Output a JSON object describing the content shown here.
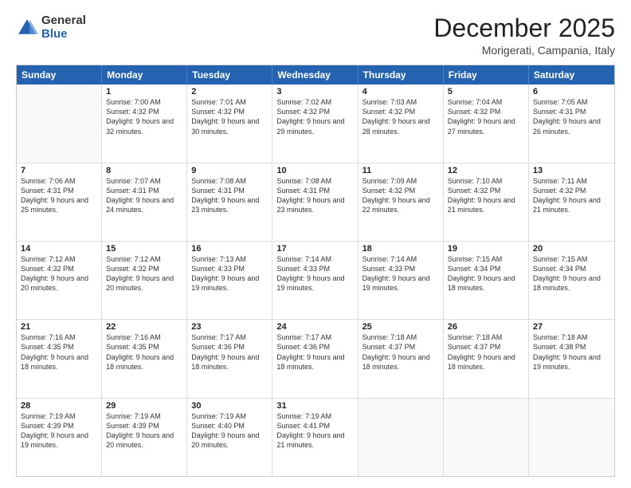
{
  "logo": {
    "general": "General",
    "blue": "Blue"
  },
  "header": {
    "title": "December 2025",
    "subtitle": "Morigerati, Campania, Italy"
  },
  "weekdays": [
    "Sunday",
    "Monday",
    "Tuesday",
    "Wednesday",
    "Thursday",
    "Friday",
    "Saturday"
  ],
  "rows": [
    [
      {
        "day": "",
        "sunrise": "",
        "sunset": "",
        "daylight": "",
        "empty": true
      },
      {
        "day": "1",
        "sunrise": "Sunrise: 7:00 AM",
        "sunset": "Sunset: 4:32 PM",
        "daylight": "Daylight: 9 hours and 32 minutes."
      },
      {
        "day": "2",
        "sunrise": "Sunrise: 7:01 AM",
        "sunset": "Sunset: 4:32 PM",
        "daylight": "Daylight: 9 hours and 30 minutes."
      },
      {
        "day": "3",
        "sunrise": "Sunrise: 7:02 AM",
        "sunset": "Sunset: 4:32 PM",
        "daylight": "Daylight: 9 hours and 29 minutes."
      },
      {
        "day": "4",
        "sunrise": "Sunrise: 7:03 AM",
        "sunset": "Sunset: 4:32 PM",
        "daylight": "Daylight: 9 hours and 28 minutes."
      },
      {
        "day": "5",
        "sunrise": "Sunrise: 7:04 AM",
        "sunset": "Sunset: 4:32 PM",
        "daylight": "Daylight: 9 hours and 27 minutes."
      },
      {
        "day": "6",
        "sunrise": "Sunrise: 7:05 AM",
        "sunset": "Sunset: 4:31 PM",
        "daylight": "Daylight: 9 hours and 26 minutes."
      }
    ],
    [
      {
        "day": "7",
        "sunrise": "Sunrise: 7:06 AM",
        "sunset": "Sunset: 4:31 PM",
        "daylight": "Daylight: 9 hours and 25 minutes."
      },
      {
        "day": "8",
        "sunrise": "Sunrise: 7:07 AM",
        "sunset": "Sunset: 4:31 PM",
        "daylight": "Daylight: 9 hours and 24 minutes."
      },
      {
        "day": "9",
        "sunrise": "Sunrise: 7:08 AM",
        "sunset": "Sunset: 4:31 PM",
        "daylight": "Daylight: 9 hours and 23 minutes."
      },
      {
        "day": "10",
        "sunrise": "Sunrise: 7:08 AM",
        "sunset": "Sunset: 4:31 PM",
        "daylight": "Daylight: 9 hours and 23 minutes."
      },
      {
        "day": "11",
        "sunrise": "Sunrise: 7:09 AM",
        "sunset": "Sunset: 4:32 PM",
        "daylight": "Daylight: 9 hours and 22 minutes."
      },
      {
        "day": "12",
        "sunrise": "Sunrise: 7:10 AM",
        "sunset": "Sunset: 4:32 PM",
        "daylight": "Daylight: 9 hours and 21 minutes."
      },
      {
        "day": "13",
        "sunrise": "Sunrise: 7:11 AM",
        "sunset": "Sunset: 4:32 PM",
        "daylight": "Daylight: 9 hours and 21 minutes."
      }
    ],
    [
      {
        "day": "14",
        "sunrise": "Sunrise: 7:12 AM",
        "sunset": "Sunset: 4:32 PM",
        "daylight": "Daylight: 9 hours and 20 minutes."
      },
      {
        "day": "15",
        "sunrise": "Sunrise: 7:12 AM",
        "sunset": "Sunset: 4:32 PM",
        "daylight": "Daylight: 9 hours and 20 minutes."
      },
      {
        "day": "16",
        "sunrise": "Sunrise: 7:13 AM",
        "sunset": "Sunset: 4:33 PM",
        "daylight": "Daylight: 9 hours and 19 minutes."
      },
      {
        "day": "17",
        "sunrise": "Sunrise: 7:14 AM",
        "sunset": "Sunset: 4:33 PM",
        "daylight": "Daylight: 9 hours and 19 minutes."
      },
      {
        "day": "18",
        "sunrise": "Sunrise: 7:14 AM",
        "sunset": "Sunset: 4:33 PM",
        "daylight": "Daylight: 9 hours and 19 minutes."
      },
      {
        "day": "19",
        "sunrise": "Sunrise: 7:15 AM",
        "sunset": "Sunset: 4:34 PM",
        "daylight": "Daylight: 9 hours and 18 minutes."
      },
      {
        "day": "20",
        "sunrise": "Sunrise: 7:15 AM",
        "sunset": "Sunset: 4:34 PM",
        "daylight": "Daylight: 9 hours and 18 minutes."
      }
    ],
    [
      {
        "day": "21",
        "sunrise": "Sunrise: 7:16 AM",
        "sunset": "Sunset: 4:35 PM",
        "daylight": "Daylight: 9 hours and 18 minutes."
      },
      {
        "day": "22",
        "sunrise": "Sunrise: 7:16 AM",
        "sunset": "Sunset: 4:35 PM",
        "daylight": "Daylight: 9 hours and 18 minutes."
      },
      {
        "day": "23",
        "sunrise": "Sunrise: 7:17 AM",
        "sunset": "Sunset: 4:36 PM",
        "daylight": "Daylight: 9 hours and 18 minutes."
      },
      {
        "day": "24",
        "sunrise": "Sunrise: 7:17 AM",
        "sunset": "Sunset: 4:36 PM",
        "daylight": "Daylight: 9 hours and 18 minutes."
      },
      {
        "day": "25",
        "sunrise": "Sunrise: 7:18 AM",
        "sunset": "Sunset: 4:37 PM",
        "daylight": "Daylight: 9 hours and 18 minutes."
      },
      {
        "day": "26",
        "sunrise": "Sunrise: 7:18 AM",
        "sunset": "Sunset: 4:37 PM",
        "daylight": "Daylight: 9 hours and 18 minutes."
      },
      {
        "day": "27",
        "sunrise": "Sunrise: 7:18 AM",
        "sunset": "Sunset: 4:38 PM",
        "daylight": "Daylight: 9 hours and 19 minutes."
      }
    ],
    [
      {
        "day": "28",
        "sunrise": "Sunrise: 7:19 AM",
        "sunset": "Sunset: 4:39 PM",
        "daylight": "Daylight: 9 hours and 19 minutes."
      },
      {
        "day": "29",
        "sunrise": "Sunrise: 7:19 AM",
        "sunset": "Sunset: 4:39 PM",
        "daylight": "Daylight: 9 hours and 20 minutes."
      },
      {
        "day": "30",
        "sunrise": "Sunrise: 7:19 AM",
        "sunset": "Sunset: 4:40 PM",
        "daylight": "Daylight: 9 hours and 20 minutes."
      },
      {
        "day": "31",
        "sunrise": "Sunrise: 7:19 AM",
        "sunset": "Sunset: 4:41 PM",
        "daylight": "Daylight: 9 hours and 21 minutes."
      },
      {
        "day": "",
        "sunrise": "",
        "sunset": "",
        "daylight": "",
        "empty": true
      },
      {
        "day": "",
        "sunrise": "",
        "sunset": "",
        "daylight": "",
        "empty": true
      },
      {
        "day": "",
        "sunrise": "",
        "sunset": "",
        "daylight": "",
        "empty": true
      }
    ]
  ]
}
